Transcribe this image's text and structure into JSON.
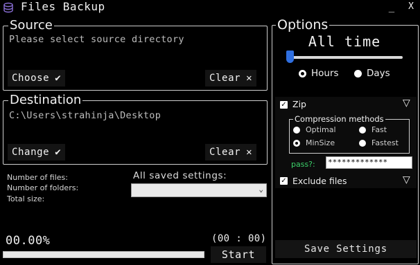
{
  "window": {
    "title": "Files Backup",
    "minimize_glyph": "_",
    "close_glyph": "X"
  },
  "source": {
    "legend": "Source",
    "placeholder": "Please select source directory",
    "choose_label": "Choose",
    "clear_label": "Clear"
  },
  "destination": {
    "legend": "Destination",
    "path": "C:\\Users\\strahinja\\Desktop",
    "change_label": "Change",
    "clear_label": "Clear"
  },
  "glyphs": {
    "check": "✔",
    "cross": "✕",
    "triangle": "▽",
    "check_box": "✓"
  },
  "info": {
    "files_label": "Number of files:",
    "folders_label": "Number of folders:",
    "size_label": "Total size:"
  },
  "saved_settings": {
    "label": "All saved settings:",
    "selected": ""
  },
  "progress": {
    "text": "00.00%",
    "fraction": 0.0,
    "timer": "(00 : 00)",
    "start_label": "Start"
  },
  "options": {
    "legend": "Options",
    "range_label": "All time",
    "slider_fraction": 0.0,
    "unit_hours": "Hours",
    "unit_days": "Days",
    "unit_selected": "Hours",
    "zip": {
      "label": "Zip",
      "checked": true
    },
    "compression": {
      "legend": "Compression methods",
      "optimal": "Optimal",
      "fast": "Fast",
      "minsize": "MinSize",
      "fastest": "Fastest",
      "selected": "MinSize"
    },
    "password": {
      "label": "pass?:",
      "value": "*************"
    },
    "exclude": {
      "label": "Exclude files",
      "checked": true
    },
    "save_label": "Save Settings"
  },
  "colors": {
    "background": "#000000",
    "accent": "#2f6fe0",
    "password_label": "#3cd16a"
  }
}
